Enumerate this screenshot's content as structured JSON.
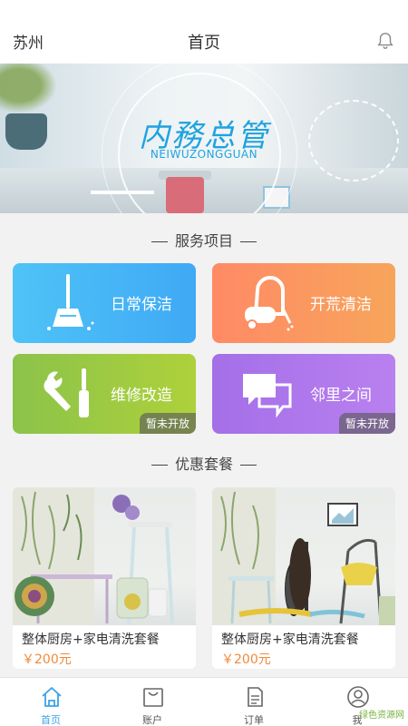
{
  "header": {
    "city": "苏州",
    "title": "首页"
  },
  "banner": {
    "logo_cn": "内務总管",
    "logo_en": "NEIWUZONGGUAN"
  },
  "services": {
    "section_title": "服务项目",
    "items": [
      {
        "label": "日常保洁",
        "icon": "broom-icon",
        "color": "#4fc3f7"
      },
      {
        "label": "开荒清洁",
        "icon": "vacuum-icon",
        "color": "#ff8a65"
      },
      {
        "label": "维修改造",
        "icon": "wrench-screwdriver-icon",
        "color": "#8bc34a",
        "badge": "暂未开放"
      },
      {
        "label": "邻里之间",
        "icon": "chat-bubbles-icon",
        "color": "#a46fe8",
        "badge": "暂未开放"
      }
    ]
  },
  "packages": {
    "section_title": "优惠套餐",
    "items": [
      {
        "name": "整体厨房+家电清洗套餐",
        "price": "￥200元"
      },
      {
        "name": "整体厨房+家电清洗套餐",
        "price": "￥200元"
      }
    ]
  },
  "tabbar": {
    "tabs": [
      {
        "label": "首页",
        "icon": "home-icon",
        "active": true
      },
      {
        "label": "账户",
        "icon": "bag-icon"
      },
      {
        "label": "订单",
        "icon": "document-icon"
      },
      {
        "label": "我",
        "icon": "user-icon"
      }
    ]
  },
  "watermark": "绿色资源网",
  "colors": {
    "accent": "#3aa4e8",
    "price": "#f08a3a"
  }
}
